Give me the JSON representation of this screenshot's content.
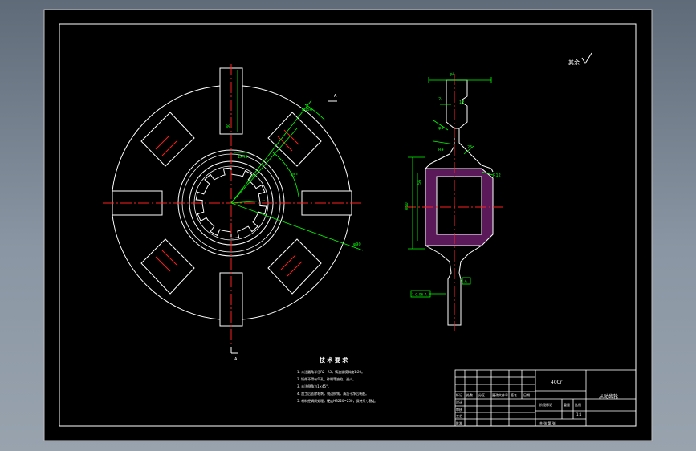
{
  "drawing": {
    "roughness_mark": "其余",
    "roughness_symbol": "√",
    "section_label_top": "A",
    "section_label_bottom": "A",
    "datum_label": "A",
    "datum_box_ref": "1 0.06 A",
    "tech_title": "技 术 要 求",
    "tech_notes": [
      "1. 未注圆角半径R2~R3，铸造拔模斜度1:20。",
      "2. 铸件不得有气孔、砂眼等缺陷，退火。",
      "3. 未注倒角为1×45°。",
      "4. 加工后去除毛刺，锐边倒钝，清洗干净后装配。",
      "5. 材料经调质处理，硬度HB220~250，保持尺寸稳定。"
    ],
    "title_block": {
      "material": "40Cr",
      "part_name": "从动齿轮",
      "scale": "1:1",
      "row_labels": [
        "设计",
        "审核",
        "工艺",
        "批准"
      ],
      "header_cells": [
        "标记",
        "处数",
        "分区",
        "更改文件号",
        "签名",
        "日期"
      ],
      "stage_label": "阶段标记",
      "weight_label": "重量",
      "scale_label": "比例",
      "sheet_label": "共  张  第  张"
    }
  },
  "colors": {
    "background": "#000000",
    "outline": "#ffffff",
    "dimension": "#00ff00",
    "centerline": "#ff2020",
    "section_hatch": "#ff00ff"
  }
}
